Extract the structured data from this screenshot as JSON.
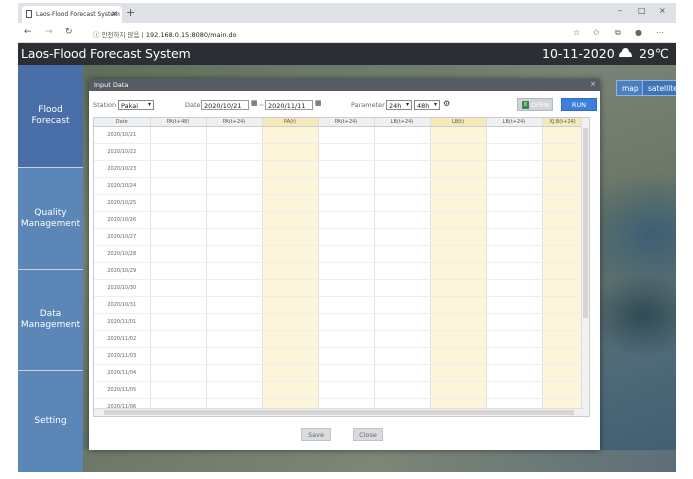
{
  "browser": {
    "tab_title": "Laos-Flood Forecast System",
    "tab_close": "×",
    "new_tab": "+",
    "window_controls": [
      "–",
      "□",
      "×"
    ],
    "nav": {
      "back": "←",
      "forward": "→",
      "reload": "↻"
    },
    "security": "ⓘ 안전하지 않음 |",
    "url": "192.168.0.15:8080/main.do"
  },
  "app": {
    "title": "Laos-Flood Forecast System",
    "date": "10-11-2020",
    "temperature": "29℃"
  },
  "sidebar": {
    "items": [
      {
        "label": "Flood Forecast",
        "active": true
      },
      {
        "label": "Quality Management"
      },
      {
        "label": "Data Management"
      },
      {
        "label": "Setting"
      }
    ]
  },
  "map": {
    "map_button": "map",
    "satellite_button": "satellite"
  },
  "modal": {
    "title": "Input Data",
    "close": "×",
    "station_label": "Station",
    "station_value": "Pakai",
    "date_label": "Date",
    "date_from": "2020/10/21",
    "date_sep": "~",
    "date_to": "2020/11/11",
    "parameter_label": "Parameter",
    "param1": "24h",
    "param2": "48h",
    "open_label": "OPEN",
    "run_label": "RUN",
    "save_label": "Save",
    "close_label": "Close"
  },
  "table": {
    "columns": [
      "Date",
      "PA(t+48)",
      "PA(t+24)",
      "PA(t)",
      "PA(t+24)",
      "LB(t+24)",
      "LB(t)",
      "LB(t+24)",
      "XJ.B(t+24)"
    ],
    "highlight_columns": [
      3,
      6,
      8
    ],
    "rows": [
      "2020/10/21",
      "2020/10/22",
      "2020/10/23",
      "2020/10/24",
      "2020/10/25",
      "2020/10/26",
      "2020/10/27",
      "2020/10/28",
      "2020/10/29",
      "2020/10/30",
      "2020/10/31",
      "2020/11/01",
      "2020/11/02",
      "2020/11/03",
      "2020/11/04",
      "2020/11/05",
      "2020/11/06"
    ]
  }
}
